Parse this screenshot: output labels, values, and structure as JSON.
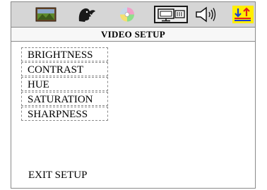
{
  "toolbar": {
    "icons": [
      {
        "name": "picture-icon",
        "selected": false
      },
      {
        "name": "face-icon",
        "selected": false
      },
      {
        "name": "disc-icon",
        "selected": false
      },
      {
        "name": "video-setup-icon",
        "selected": true
      },
      {
        "name": "speaker-icon",
        "selected": false
      },
      {
        "name": "preference-icon",
        "selected": false
      }
    ]
  },
  "title": "VIDEO SETUP",
  "menu": {
    "items": [
      "BRIGHTNESS",
      "CONTRAST",
      "HUE",
      "SATURATION",
      "SHARPNESS"
    ]
  },
  "exit_label": "EXIT SETUP",
  "colors": {
    "toolbar_bg": "#d6d6d6",
    "highlight_yellow": "#ffee00",
    "arrow_red": "#e02020",
    "arrow_blue": "#1a3fd0"
  }
}
